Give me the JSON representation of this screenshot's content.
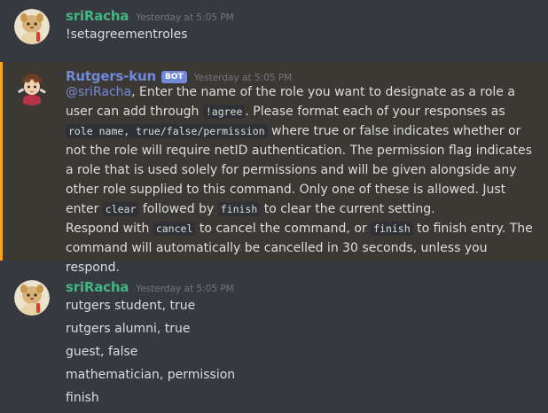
{
  "messages": [
    {
      "author": "sriRacha",
      "author_color": "#43b581",
      "timestamp": "Yesterday at 5:05 PM",
      "lines": [
        "!setagreementroles"
      ]
    },
    {
      "author": "Rutgers-kun",
      "author_color": "#7289da",
      "bot_tag": "BOT",
      "timestamp": "Yesterday at 5:05 PM",
      "mention": "@sriRacha",
      "parts": {
        "p1": ", Enter the name of the role you want to designate as a  role a user can add through ",
        "c1": "!agree",
        "p2": ". Please format each of your responses as ",
        "c2": "role name, true/false/permission",
        "p3": " where true or false indicates whether or not the role will require netID authentication. The permission flag indicates a role that is used solely for permissions and will be given alongside any other role supplied to this command. Only one of these is allowed. Just enter ",
        "c3": "clear",
        "p4": " followed by ",
        "c4": "finish",
        "p5": " to clear the current setting.",
        "p6": "Respond with ",
        "c5": "cancel",
        "p7": " to cancel the command, or ",
        "c6": "finish",
        "p8": " to finish entry. The command will automatically be cancelled in 30 seconds, unless you respond."
      }
    },
    {
      "author": "sriRacha",
      "author_color": "#43b581",
      "timestamp": "Yesterday at 5:05 PM",
      "lines": [
        "rutgers student, true",
        "rutgers alumni, true",
        "guest, false",
        "mathematician, permission",
        "finish"
      ]
    }
  ],
  "colors": {
    "background": "#36393f",
    "mention_highlight": "#3c3935",
    "mention_bar": "#faa61a"
  },
  "icons": {
    "sriRacha_avatar": "cartoon-avatar-icon",
    "bot_avatar": "anime-avatar-icon"
  }
}
